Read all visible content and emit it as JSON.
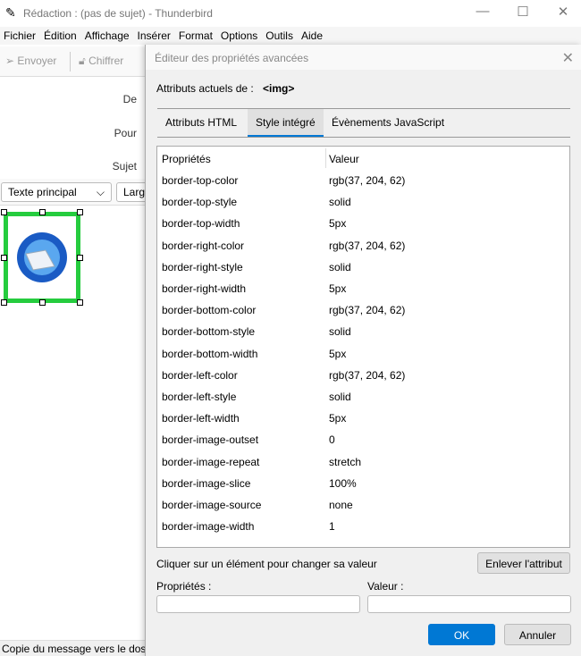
{
  "window": {
    "title": "Rédaction : (pas de sujet) - Thunderbird",
    "minimize": "—",
    "maximize": "☐",
    "close": "✕"
  },
  "menu": [
    "Fichier",
    "Édition",
    "Affichage",
    "Insérer",
    "Format",
    "Options",
    "Outils",
    "Aide"
  ],
  "toolbar": {
    "send": "Envoyer",
    "encrypt": "Chiffrer"
  },
  "headers": {
    "from": "De",
    "to": "Pour",
    "subject": "Sujet"
  },
  "format": {
    "paragraph": "Texte principal",
    "width": "Larg"
  },
  "status": "Copie du message vers le dossier",
  "dialog": {
    "title": "Éditeur des propriétés avancées",
    "current_label": "Attributs actuels de :",
    "current_tag": "<img>",
    "tabs": [
      "Attributs HTML",
      "Style intégré",
      "Évènements JavaScript"
    ],
    "active_tab": 1,
    "columns": [
      "Propriétés",
      "Valeur"
    ],
    "rows": [
      [
        "border-top-color",
        "rgb(37, 204, 62)"
      ],
      [
        "border-top-style",
        "solid"
      ],
      [
        "border-top-width",
        "5px"
      ],
      [
        "border-right-color",
        "rgb(37, 204, 62)"
      ],
      [
        "border-right-style",
        "solid"
      ],
      [
        "border-right-width",
        "5px"
      ],
      [
        "border-bottom-color",
        "rgb(37, 204, 62)"
      ],
      [
        "border-bottom-style",
        "solid"
      ],
      [
        "border-bottom-width",
        "5px"
      ],
      [
        "border-left-color",
        "rgb(37, 204, 62)"
      ],
      [
        "border-left-style",
        "solid"
      ],
      [
        "border-left-width",
        "5px"
      ],
      [
        "border-image-outset",
        "0"
      ],
      [
        "border-image-repeat",
        "stretch"
      ],
      [
        "border-image-slice",
        "100%"
      ],
      [
        "border-image-source",
        "none"
      ],
      [
        "border-image-width",
        "1"
      ]
    ],
    "hint": "Cliquer sur un élément pour changer sa valeur",
    "remove": "Enlever l'attribut",
    "prop_label": "Propriétés :",
    "value_label": "Valeur :",
    "prop_value": "",
    "value_value": "",
    "ok": "OK",
    "cancel": "Annuler"
  },
  "colors": {
    "accent": "#0078d4",
    "border_green": "#25cc3e"
  }
}
